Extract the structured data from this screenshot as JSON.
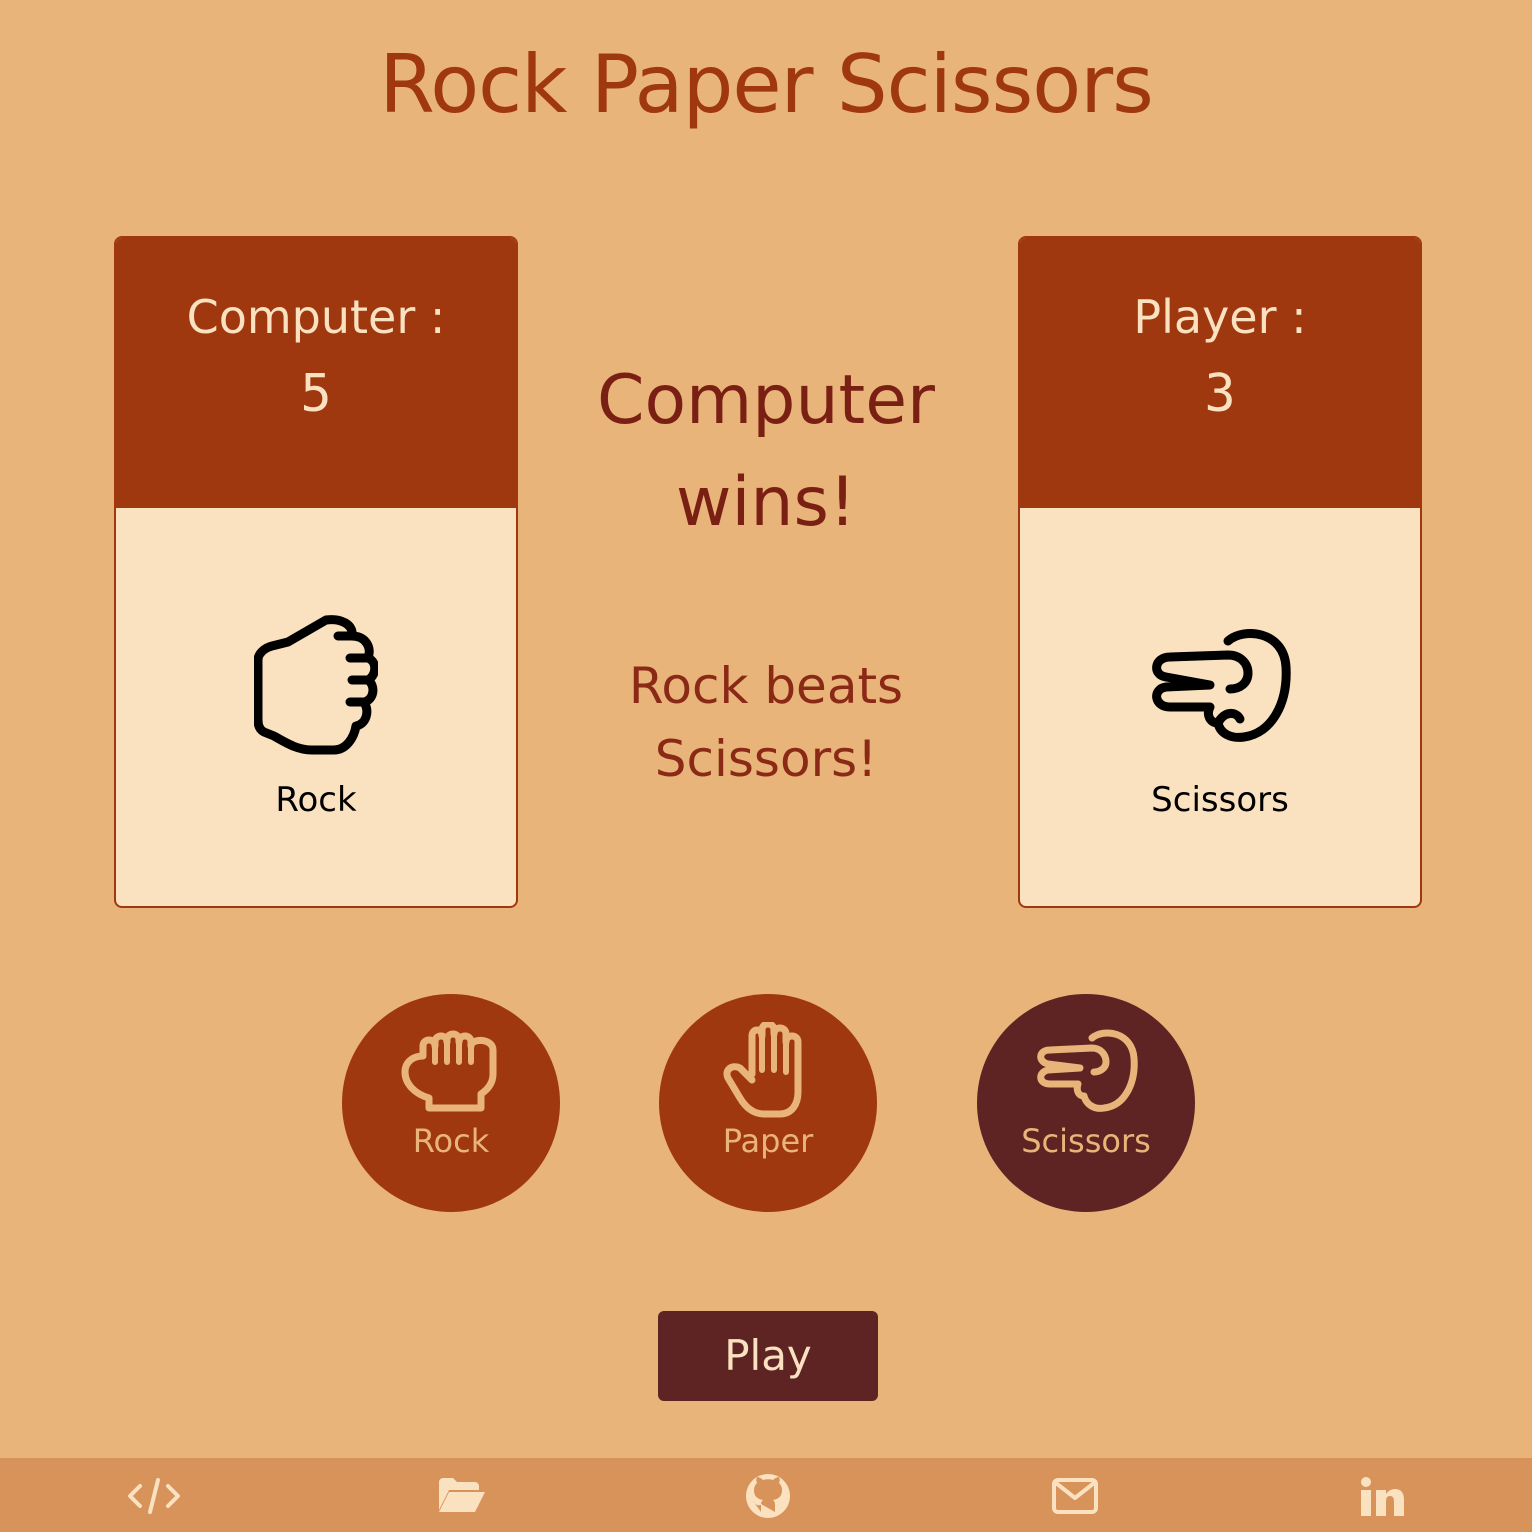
{
  "app": {
    "title": "Rock Paper Scissors"
  },
  "computer": {
    "label": "Computer :",
    "score": "5",
    "choice": "Rock",
    "choice_icon": "fist-icon"
  },
  "player": {
    "label": "Player :",
    "score": "3",
    "choice": "Scissors",
    "choice_icon": "scissors-hand-icon"
  },
  "result": {
    "headline": "Computer wins!",
    "detail": "Rock beats Scissors!"
  },
  "picks": [
    {
      "label": "Rock",
      "icon": "fist-icon",
      "selected": false
    },
    {
      "label": "Paper",
      "icon": "open-hand-icon",
      "selected": false
    },
    {
      "label": "Scissors",
      "icon": "scissors-hand-icon",
      "selected": true
    }
  ],
  "play_button": {
    "label": "Play"
  },
  "footer": {
    "icons": [
      "code-icon",
      "folder-icon",
      "github-icon",
      "mail-icon",
      "linkedin-icon"
    ]
  },
  "colors": {
    "background": "#e9b47a",
    "accent": "#a0380f",
    "dark": "#5e2424",
    "card": "#fae2c0",
    "footer": "#d8935a"
  }
}
